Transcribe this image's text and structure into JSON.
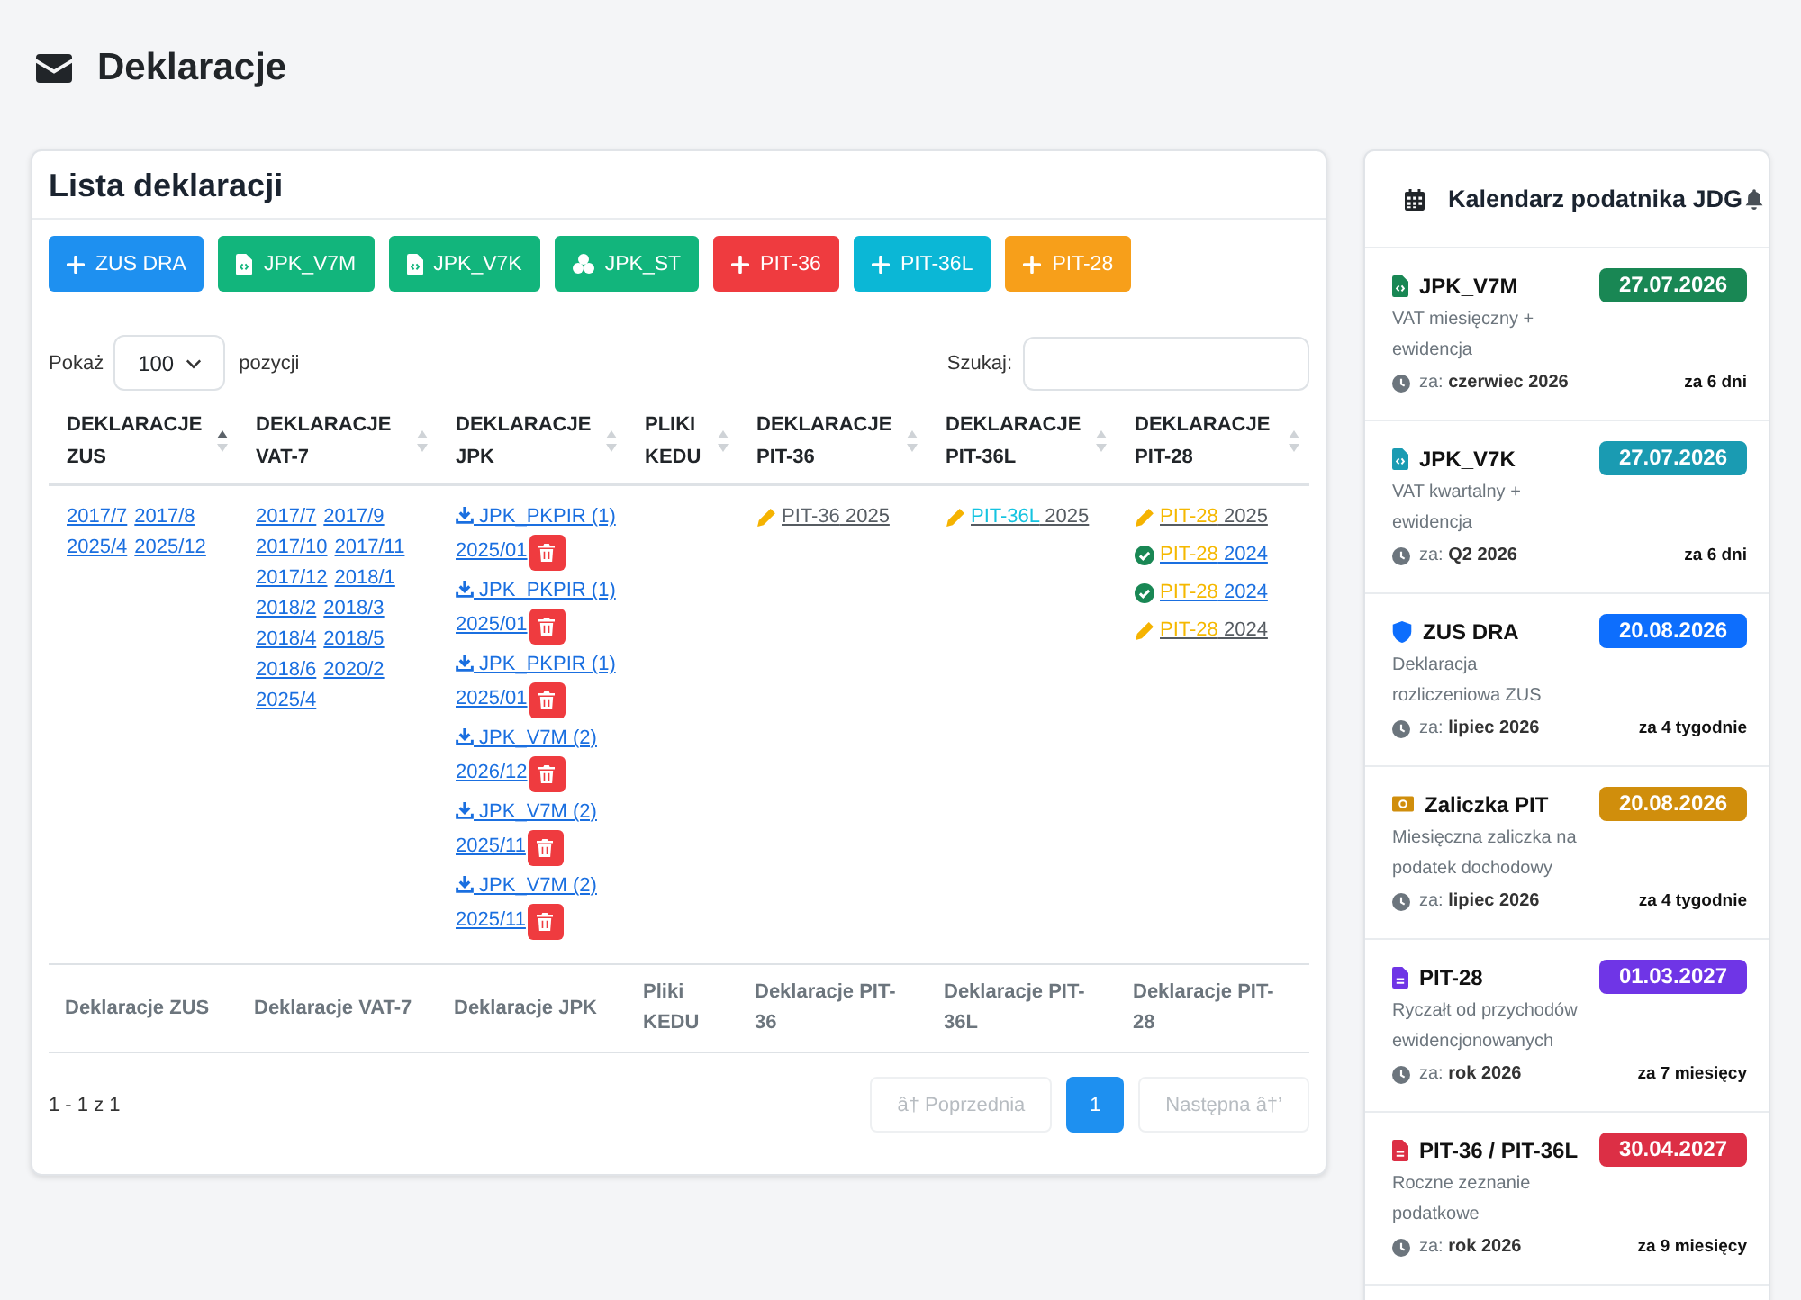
{
  "page_title": "Deklaracje",
  "declarations_card": {
    "title": "Lista deklaracji",
    "add_buttons": [
      {
        "label": "ZUS DRA",
        "kind": "plus",
        "color": "#1e90f0"
      },
      {
        "label": "JPK_V7M",
        "kind": "file-code",
        "color": "#12b57c"
      },
      {
        "label": "JPK_V7K",
        "kind": "file-code",
        "color": "#12b57c"
      },
      {
        "label": "JPK_ST",
        "kind": "cubes",
        "color": "#12b57c"
      },
      {
        "label": "PIT-36",
        "kind": "plus",
        "color": "#ef3b3f"
      },
      {
        "label": "PIT-36L",
        "kind": "plus",
        "color": "#0bb7d6"
      },
      {
        "label": "PIT-28",
        "kind": "plus",
        "color": "#f79f1a"
      }
    ],
    "page_length": {
      "label_before": "Pokaż",
      "value": "100",
      "label_after": "pozycji"
    },
    "search": {
      "label": "Szukaj:"
    },
    "table": {
      "columns": [
        {
          "label": "DEKLARACJE ZUS",
          "sorted": true
        },
        {
          "label": "DEKLARACJE VAT-7",
          "sorted": false
        },
        {
          "label": "DEKLARACJE JPK",
          "sorted": false
        },
        {
          "label": "PLIKI KEDU",
          "sorted": false
        },
        {
          "label": "DEKLARACJE PIT-36",
          "sorted": false
        },
        {
          "label": "DEKLARACJE PIT-36L",
          "sorted": false
        },
        {
          "label": "DEKLARACJE PIT-28",
          "sorted": false
        }
      ],
      "rows": [
        {
          "cells": [
            {
              "kind": "links",
              "links": [
                "2017/7",
                "2017/8",
                "2025/4",
                "2025/12"
              ]
            },
            {
              "kind": "links",
              "links": [
                "2017/7",
                "2017/9",
                "2017/10",
                "2017/11",
                "2017/12",
                "2018/1",
                "2018/2",
                "2018/3",
                "2018/4",
                "2018/5",
                "2018/6",
                "2020/2",
                "2025/4"
              ]
            },
            {
              "kind": "files",
              "files": [
                {
                  "name": "JPK_PKPIR (1)",
                  "period": "2025/01"
                },
                {
                  "name": "JPK_PKPIR (1)",
                  "period": "2025/01"
                },
                {
                  "name": "JPK_PKPIR (1)",
                  "period": "2025/01"
                },
                {
                  "name": "JPK_V7M (2)",
                  "period": "2026/12"
                },
                {
                  "name": "JPK_V7M (2)",
                  "period": "2025/11"
                },
                {
                  "name": "JPK_V7M (2)",
                  "period": "2025/11"
                }
              ]
            },
            {
              "kind": "empty"
            },
            {
              "kind": "forms",
              "color": "#5c636a",
              "entries": [
                {
                  "form": "PIT-36",
                  "year": "2025",
                  "submitted": false
                }
              ]
            },
            {
              "kind": "forms",
              "color": "#14c3e0",
              "entries": [
                {
                  "form": "PIT-36L",
                  "year": "2025",
                  "submitted": false
                }
              ]
            },
            {
              "kind": "forms",
              "color": "#f5b800",
              "entries": [
                {
                  "form": "PIT-28",
                  "year": "2025",
                  "submitted": false
                },
                {
                  "form": "PIT-28",
                  "year": "2024",
                  "submitted": true
                },
                {
                  "form": "PIT-28",
                  "year": "2024",
                  "submitted": true
                },
                {
                  "form": "PIT-28",
                  "year": "2024",
                  "submitted": false
                }
              ]
            }
          ]
        }
      ],
      "footer": [
        "Deklaracje ZUS",
        "Deklaracje VAT-7",
        "Deklaracje JPK",
        "Pliki KEDU",
        "Deklaracje PIT-36",
        "Deklaracje PIT-36L",
        "Deklaracje PIT-28"
      ]
    },
    "info": "1 - 1 z 1",
    "pagination": {
      "previous": {
        "label": "â† Poprzednia",
        "disabled": true
      },
      "pages": [
        {
          "label": "1",
          "selected": true
        }
      ],
      "next": {
        "label": "Następna â†’",
        "disabled": true
      }
    }
  },
  "calendar": {
    "title": "Kalendarz podatnika JDG",
    "items": [
      {
        "kind": "file-code",
        "title": "JPK_V7M",
        "date": "27.07.2026",
        "color": "#198754",
        "description": "VAT miesięczny + ewidencja",
        "period": "za: **czerwiec 2026**",
        "due": "za 6 dni"
      },
      {
        "kind": "file-code",
        "title": "JPK_V7K",
        "date": "27.07.2026",
        "color": "#1a9bb2",
        "description": "VAT kwartalny + ewidencja",
        "period": "za: **Q2 2026**",
        "due": "za 6 dni"
      },
      {
        "kind": "shield",
        "title": "ZUS DRA",
        "date": "20.08.2026",
        "color": "#0d6efd",
        "description": "Deklaracja rozliczeniowa ZUS",
        "period": "za: **lipiec 2026**",
        "due": "za 4 tygodnie"
      },
      {
        "kind": "money",
        "title": "Zaliczka PIT",
        "date": "20.08.2026",
        "color": "#d08e0c",
        "description": "Miesięczna zaliczka na podatek dochodowy",
        "period": "za: **lipiec 2026**",
        "due": "za 4 tygodnie"
      },
      {
        "kind": "file",
        "title": "PIT-28",
        "date": "01.03.2027",
        "color": "#6f35e6",
        "description": "Ryczałt od przychodów ewidencjonowanych",
        "period": "za: **rok 2026**",
        "due": "za 7 miesięcy"
      },
      {
        "kind": "file",
        "title": "PIT-36 / PIT-36L",
        "date": "30.04.2027",
        "color": "#dc2f45",
        "description": "Roczne zeznanie podatkowe",
        "period": "za: **rok 2026**",
        "due": "za 9 miesięcy"
      }
    ]
  }
}
